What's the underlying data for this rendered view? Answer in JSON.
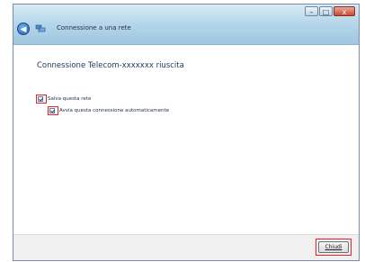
{
  "window": {
    "title": "Connessione a una rete",
    "controls": {
      "minimize": "–",
      "maximize": "□",
      "close": "x"
    }
  },
  "nav": {
    "back_icon": "back-arrow-icon",
    "network_icon": "network-icon"
  },
  "main": {
    "heading": "Connessione Telecom-xxxxxxx riuscita",
    "save_network_label": "Salva questa rete",
    "auto_connect_label": "Avvia questa connessione automaticamente"
  },
  "footer": {
    "close_label": "Chiudi"
  },
  "colors": {
    "highlight": "#e0242b",
    "title_gradient_top": "#d8ecf7",
    "title_gradient_bottom": "#9ec6df",
    "heading_text": "#1e395b"
  }
}
